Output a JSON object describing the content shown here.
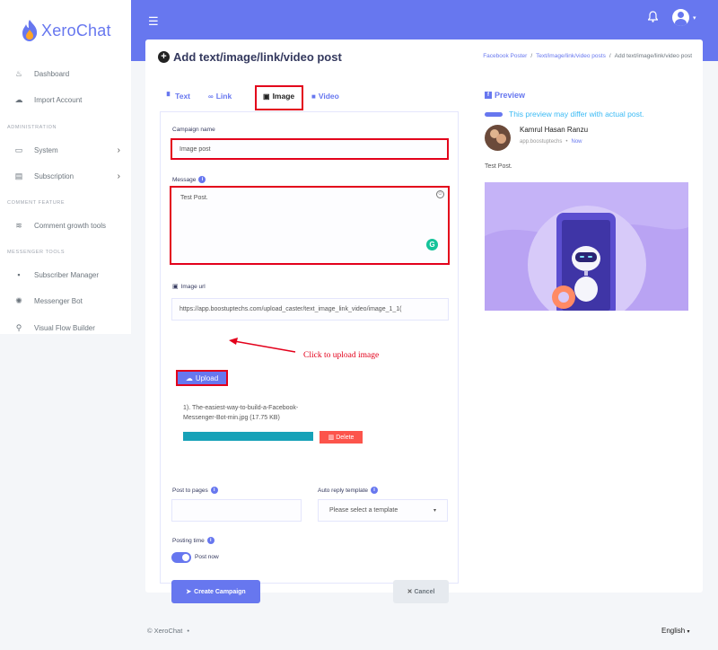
{
  "brand": {
    "name": "XeroChat"
  },
  "sidebar": {
    "items": [
      {
        "label": "Dashboard",
        "icon": "fire-icon",
        "glyph": "♨"
      },
      {
        "label": "Import Account",
        "icon": "cloud-download-icon",
        "glyph": "☁"
      },
      {
        "label": "System",
        "icon": "laptop-icon",
        "glyph": "▭"
      },
      {
        "label": "Subscription",
        "icon": "coins-icon",
        "glyph": "▤"
      },
      {
        "label": "Comment growth tools",
        "icon": "layer-group-icon",
        "glyph": "≋"
      },
      {
        "label": "Subscriber Manager",
        "icon": "user-square-icon",
        "glyph": "▪"
      },
      {
        "label": "Messenger Bot",
        "icon": "robot-icon",
        "glyph": "✺"
      },
      {
        "label": "Visual Flow Builder",
        "icon": "project-diagram-icon",
        "glyph": "⚲"
      }
    ],
    "headers": {
      "administration": "ADMINISTRATION",
      "comment_feature": "COMMENT FEATURE",
      "messenger_tools": "MESSENGER TOOLS"
    }
  },
  "page": {
    "title": "Add text/image/link/video post",
    "breadcrumb": [
      "Facebook Poster",
      "/",
      "Text/image/link/video posts",
      "/",
      "Add text/image/link/video post"
    ]
  },
  "tabs": [
    {
      "label": "Text",
      "glyph": "▘"
    },
    {
      "label": "Link",
      "glyph": "∞"
    },
    {
      "label": "Image",
      "glyph": "▣"
    },
    {
      "label": "Video",
      "glyph": "■"
    }
  ],
  "form": {
    "campaign_name_label": "Campaign name",
    "campaign_name_value": "Image post",
    "message_label": "Message",
    "message_value": "Test Post.",
    "image_url_label": "Image url",
    "image_url_value": "https://app.boostuptechs.com/upload_caster/text_image_link_video/image_1_1(",
    "upload_label": "Upload",
    "upload_annotation": "Click to upload image",
    "uploaded_file": "1). The-easiest-way-to-build-a-Facebook-Messenger-Bot-min.jpg (17.75 KB)",
    "upload_progress": 1.0,
    "delete_label": "Delete",
    "post_to_pages_label": "Post to pages",
    "auto_reply_label": "Auto reply template",
    "auto_reply_value": "Please select a template",
    "posting_time_label": "Posting time",
    "post_now_label": "Post now",
    "create_label": "Create Campaign",
    "cancel_label": "Cancel"
  },
  "preview": {
    "title": "Preview",
    "note": "This preview may differ with actual post.",
    "author": "Kamrul Hasan Ranzu",
    "app": "app.boostuptechs",
    "dot": "•",
    "time": "Now",
    "text": "Test Post."
  },
  "footer": {
    "copyright": "© XeroChat",
    "dot": "•",
    "language": "English"
  },
  "colors": {
    "primary": "#6777ef",
    "annotation_red": "#e3001b",
    "progress": "#17a2b8",
    "danger": "#fc544b",
    "info": "#3abaf4"
  }
}
